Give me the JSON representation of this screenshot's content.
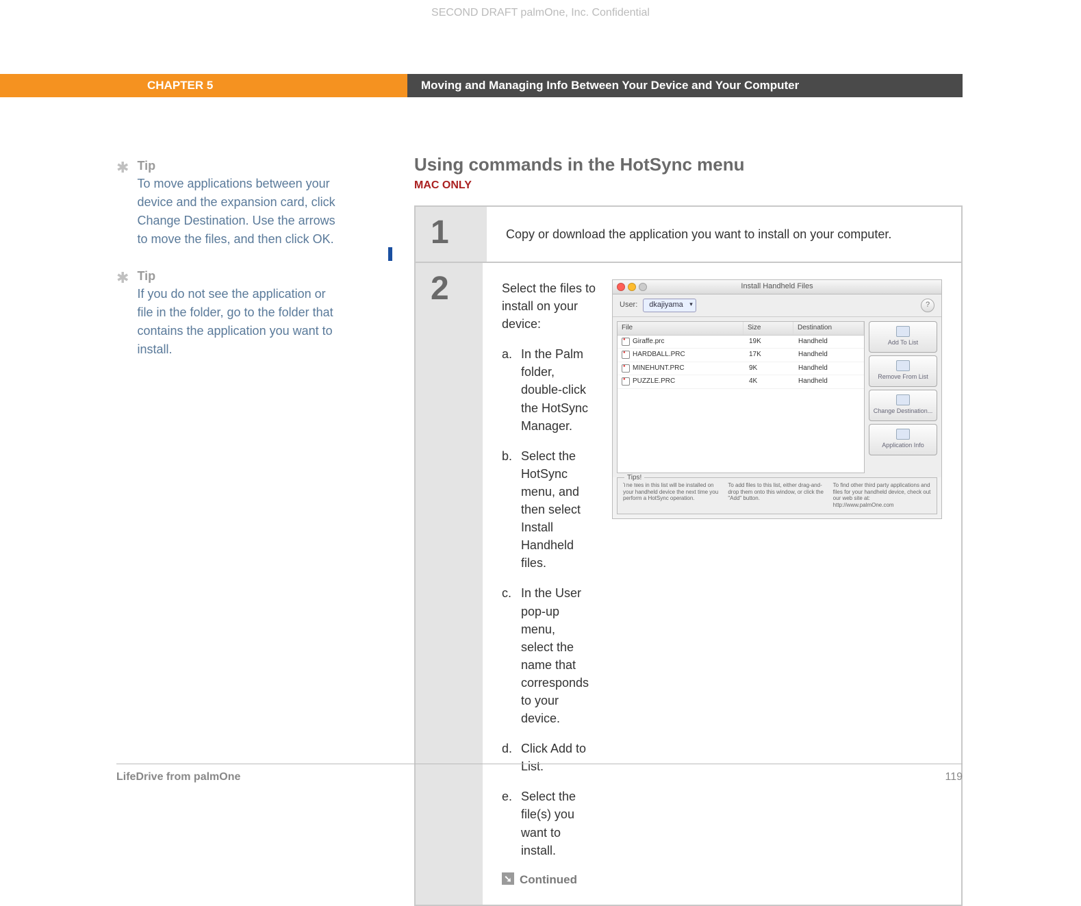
{
  "header_watermark": "SECOND DRAFT palmOne, Inc.  Confidential",
  "chapter_label": "CHAPTER 5",
  "page_title": "Moving and Managing Info Between Your Device and Your Computer",
  "sidebar": {
    "tips": [
      {
        "label": "Tip",
        "text": "To move applications between your device and the expansion card, click Change Destination. Use the arrows to move the files, and then click OK."
      },
      {
        "label": "Tip",
        "text": "If you do not see the application or file in the folder, go to the folder that contains the application you want to install."
      }
    ]
  },
  "main": {
    "heading": "Using commands in the HotSync menu",
    "platform_note": "MAC ONLY",
    "steps": [
      {
        "num": "1",
        "text": "Copy or download the application you want to install on your computer."
      },
      {
        "num": "2",
        "intro": "Select the files to install on your device:",
        "items": [
          {
            "letter": "a.",
            "text": "In the Palm folder, double-click the HotSync Manager."
          },
          {
            "letter": "b.",
            "text": "Select the HotSync menu, and then select Install Handheld files."
          },
          {
            "letter": "c.",
            "text": "In the User pop-up menu, select the name that corresponds to your device."
          },
          {
            "letter": "d.",
            "text": "Click Add to List."
          },
          {
            "letter": "e.",
            "text": "Select the file(s) you want to install."
          }
        ],
        "continued": "Continued"
      }
    ]
  },
  "screenshot": {
    "window_title": "Install Handheld Files",
    "user_label": "User:",
    "user_value": "dkajiyama",
    "help_glyph": "?",
    "columns": {
      "file": "File",
      "size": "Size",
      "dest": "Destination"
    },
    "rows": [
      {
        "file": "Giraffe.prc",
        "size": "19K",
        "dest": "Handheld"
      },
      {
        "file": "HARDBALL.PRC",
        "size": "17K",
        "dest": "Handheld"
      },
      {
        "file": "MINEHUNT.PRC",
        "size": "9K",
        "dest": "Handheld"
      },
      {
        "file": "PUZZLE.PRC",
        "size": "4K",
        "dest": "Handheld"
      }
    ],
    "buttons": {
      "add": "Add To List",
      "remove": "Remove From List",
      "change": "Change Destination...",
      "info": "Application Info"
    },
    "tips_legend": "Tips!",
    "tips_cols": [
      "The files in this list will be installed on your handheld device the next time you perform a HotSync operation.",
      "To add files to this list, either drag-and-drop them onto this window, or click the \"Add\" button.",
      "To find other third party applications and files for your handheld device, check out our web site at: http://www.palmOne.com"
    ]
  },
  "footer": {
    "left": "LifeDrive from palmOne",
    "right": "119"
  }
}
